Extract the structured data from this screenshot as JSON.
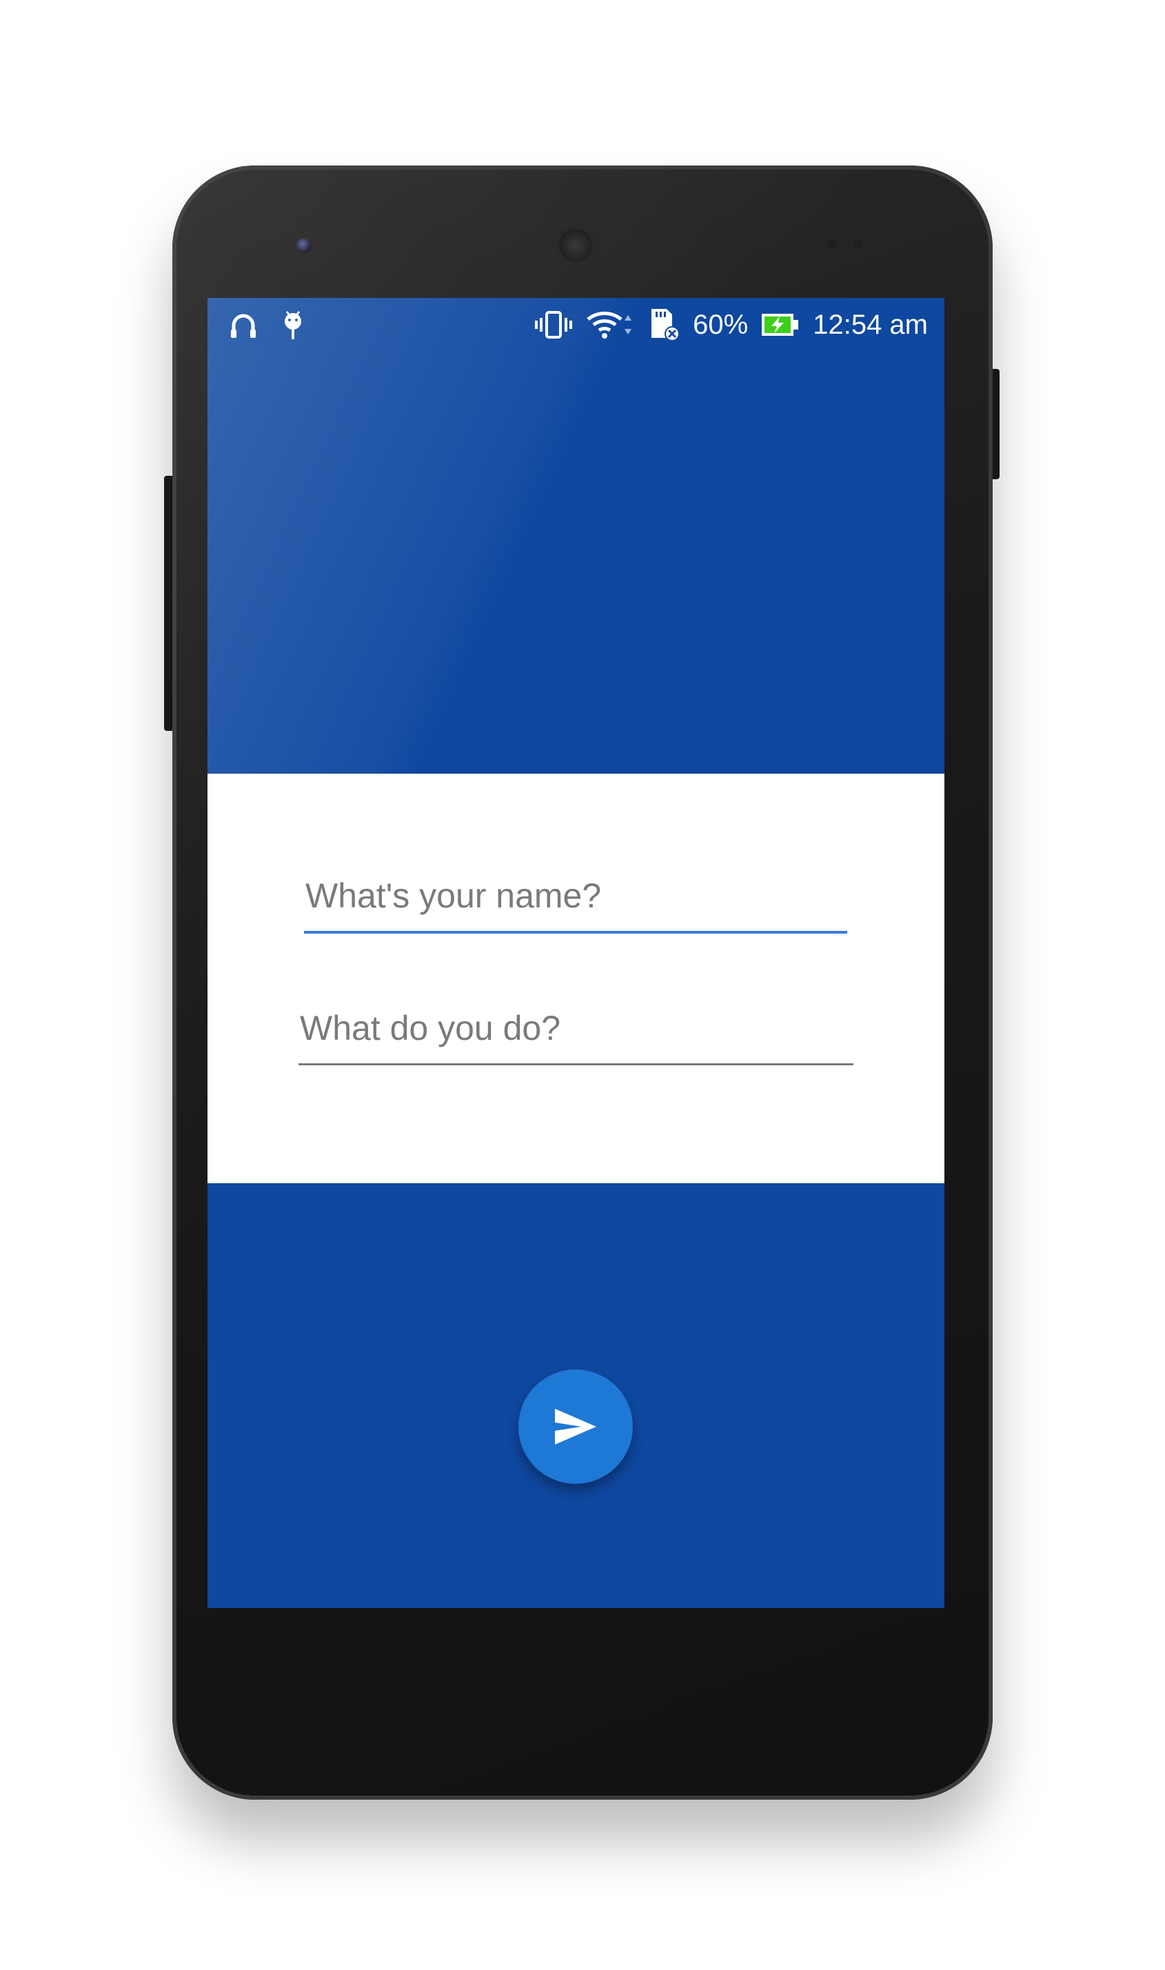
{
  "status_bar": {
    "icons_left": [
      "headset-icon",
      "android-debug-icon"
    ],
    "icons_right": [
      "vibrate-icon",
      "wifi-icon",
      "sd-card-icon",
      "battery-charging-icon"
    ],
    "battery_percent": "60%",
    "time": "12:54 am"
  },
  "form": {
    "name_field": {
      "placeholder": "What's your name?",
      "value": ""
    },
    "job_field": {
      "placeholder": "What do you do?",
      "value": ""
    }
  },
  "fab": {
    "icon": "send-icon"
  },
  "colors": {
    "primary": "#0f48a0",
    "accent": "#1e78d6",
    "focus_underline": "#3a7bd5",
    "battery_green": "#3ecf1a"
  }
}
